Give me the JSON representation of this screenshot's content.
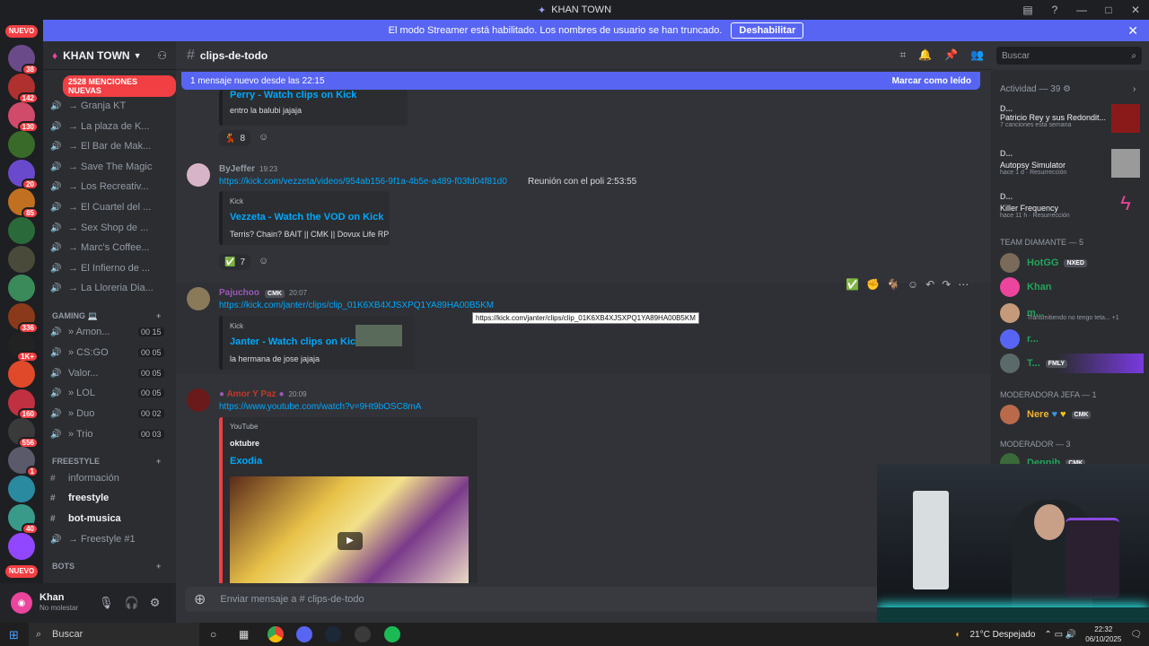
{
  "app": {
    "title": "KHAN TOWN",
    "window_controls": [
      "—",
      "□",
      "✕"
    ]
  },
  "streamer_banner": {
    "text": "El modo Streamer está habilitado. Los nombres de usuario se han truncado.",
    "button": "Deshabilitar"
  },
  "server_list": {
    "nuevo_top": "NUEVO",
    "nuevo_bottom": "NUEVO",
    "badges": [
      "38",
      "142",
      "130",
      "20",
      "85",
      "336",
      "1K+",
      "160",
      "556",
      "1",
      "40"
    ]
  },
  "guild": {
    "name": "KHAN TOWN",
    "mentions": "2528 MENCIONES NUEVAS",
    "channels": [
      {
        "label": "→ Granja KT"
      },
      {
        "label": "→ La plaza de K..."
      },
      {
        "label": "→ El Bar de Mak..."
      },
      {
        "label": "→ Save The Magic"
      },
      {
        "label": "→ Los Recreativ..."
      },
      {
        "label": "→ El Cuartel del ..."
      },
      {
        "label": "→ Sex Shop de ..."
      },
      {
        "label": "→ Marc's Coffee..."
      },
      {
        "label": "→ El Infierno de ..."
      },
      {
        "label": "→ La Lloreria Dia..."
      }
    ],
    "gaming_category": "GAMING 💻",
    "gaming_channels": [
      {
        "label": "» Amon...",
        "count": "00 15"
      },
      {
        "label": "» CS:GO",
        "count": "00 05"
      },
      {
        "label": "Valor...",
        "count": "00 05"
      },
      {
        "label": "» LOL",
        "count": "00 05"
      },
      {
        "label": "» Duo",
        "count": "00 02"
      },
      {
        "label": "» Trio",
        "count": "00 03"
      }
    ],
    "freestyle_category": "FREESTYLE",
    "freestyle_channels": [
      {
        "label": "información"
      },
      {
        "label": "freestyle"
      },
      {
        "label": "bot-musica"
      },
      {
        "label": "→ Freestyle #1"
      }
    ],
    "bots_category": "BOTS"
  },
  "user": {
    "name": "Khan",
    "status": "No molestar"
  },
  "channel": {
    "name": "clips-de-todo"
  },
  "search": {
    "placeholder": "Buscar"
  },
  "new_messages": {
    "text": "1 mensaje nuevo desde las 22:15",
    "mark": "Marcar como leído"
  },
  "messages": {
    "m0": {
      "embed_title": "Perry - Watch clips on Kick",
      "embed_desc": "entro la balubi jajaja",
      "reaction_count": "8"
    },
    "m1": {
      "author": "ByJeffer",
      "time": "19:23",
      "link": "https://kick.com/vezzeta/videos/954ab156-9f1a-4b5e-a489-f03fd04f81d0",
      "text": "Reunión con el poli 2:53:55",
      "provider": "Kick",
      "embed_title": "Vezzeta - Watch the VOD on Kick",
      "embed_desc": "Terris? Chain? BAIT || CMK || Dovux Life RP",
      "reaction_count": "7"
    },
    "m2": {
      "author": "Pajuchoo",
      "tag": "CMK",
      "time": "20:07",
      "link": "https://kick.com/janter/clips/clip_01K6XB4XJSXPQ1YA89HA00B5KM",
      "tooltip": "https://kick.com/janter/clips/clip_01K6XB4XJSXPQ1YA89HA00B5KM",
      "provider": "Kick",
      "embed_title": "Janter - Watch clips on Kick",
      "embed_desc": "la hermana de jose jajaja"
    },
    "m3": {
      "author": "Amor Y Paz",
      "time": "20:09",
      "link": "https://www.youtube.com/watch?v=9Ht9bOSC8mA",
      "provider": "YouTube",
      "embed_author": "oktubre",
      "embed_title": "Exodia"
    }
  },
  "composer": {
    "placeholder": "Enviar mensaje a #  clips-de-todo"
  },
  "activity": {
    "header": "Actividad — 39",
    "items": [
      {
        "name": "D...",
        "title": "Patricio Rey y sus Redondit...",
        "sub": "7 canciones esta semana"
      },
      {
        "name": "D...",
        "title": "Autopsy Simulator",
        "sub": "hace 1 d  ·  Resurrección"
      },
      {
        "name": "D...",
        "title": "Killer Frequency",
        "sub": "hace 11 h  ·  Resurrección"
      }
    ]
  },
  "members": {
    "role1": "TEAM DIAMANTE — 5",
    "list1": [
      {
        "name": "HotGG",
        "tag": "NXED",
        "color": "#23a55a"
      },
      {
        "name": "Khan",
        "tag": "",
        "color": "#23a55a"
      },
      {
        "name": "m...",
        "tag": "",
        "color": "#23a55a",
        "sub": "Transmitiendo no tengo teta... +1"
      },
      {
        "name": "r...",
        "tag": "",
        "color": "#23a55a"
      },
      {
        "name": "T...",
        "tag": "FMLY",
        "color": "#23a55a"
      }
    ],
    "role2": "MODERADORA JEFA — 1",
    "list2": [
      {
        "name": "Nere",
        "tag": "CMK",
        "color": "#f0b232"
      }
    ],
    "role3": "MODERADOR — 3",
    "list3": [
      {
        "name": "Dennih",
        "tag": "CMK",
        "color": "#23a55a"
      }
    ]
  },
  "taskbar": {
    "search": "Buscar",
    "weather": "21°C  Despejado",
    "time": "22:32",
    "date": "06/10/2025"
  },
  "colors": {
    "accent": "#5865f2",
    "danger": "#f23f43",
    "link": "#00a8fc"
  }
}
